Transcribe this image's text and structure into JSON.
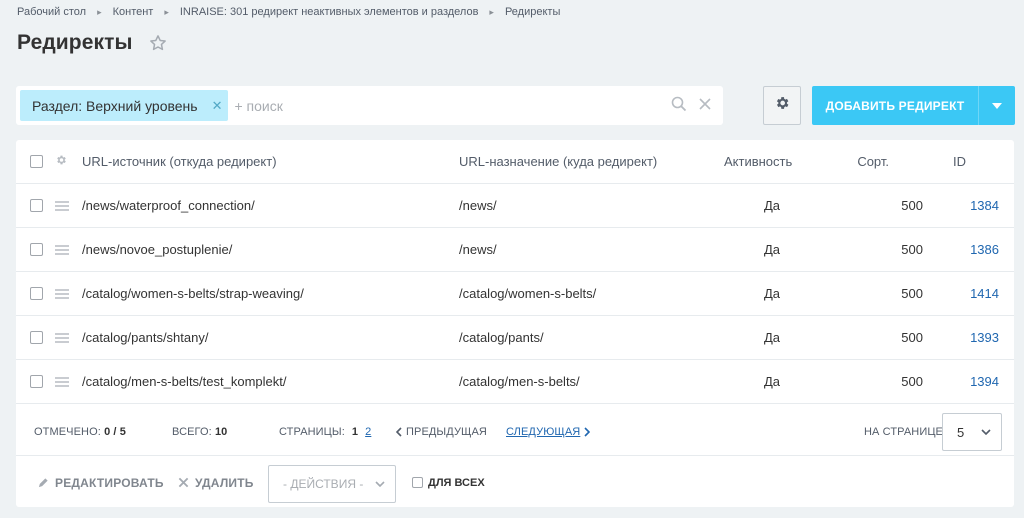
{
  "breadcrumbs": [
    {
      "label": "Рабочий стол"
    },
    {
      "label": "Контент"
    },
    {
      "label": "INRAISE: 301 редирект неактивных элементов и разделов"
    },
    {
      "label": "Редиректы"
    }
  ],
  "page": {
    "title": "Редиректы"
  },
  "filter": {
    "tag_label": "Раздел: Верхний уровень",
    "search_placeholder": "+ поиск"
  },
  "toolbar": {
    "add_label": "ДОБАВИТЬ РЕДИРЕКТ"
  },
  "table": {
    "columns": {
      "source": "URL-источник (откуда редирект)",
      "target": "URL-назначение (куда редирект)",
      "active": "Активность",
      "sort": "Сорт.",
      "id": "ID"
    },
    "rows": [
      {
        "source": "/news/waterproof_connection/",
        "target": "/news/",
        "active": "Да",
        "sort": "500",
        "id": "1384"
      },
      {
        "source": "/news/novoe_postuplenie/",
        "target": "/news/",
        "active": "Да",
        "sort": "500",
        "id": "1386"
      },
      {
        "source": "/catalog/women-s-belts/strap-weaving/",
        "target": "/catalog/women-s-belts/",
        "active": "Да",
        "sort": "500",
        "id": "1414"
      },
      {
        "source": "/catalog/pants/shtany/",
        "target": "/catalog/pants/",
        "active": "Да",
        "sort": "500",
        "id": "1393"
      },
      {
        "source": "/catalog/men-s-belts/test_komplekt/",
        "target": "/catalog/men-s-belts/",
        "active": "Да",
        "sort": "500",
        "id": "1394"
      }
    ]
  },
  "footer": {
    "checked_label": "ОТМЕЧЕНО:",
    "checked_value": "0 / 5",
    "total_label": "ВСЕГО:",
    "total_value": "10",
    "pages_label": "СТРАНИЦЫ:",
    "page_current": "1",
    "page_next": "2",
    "prev_label": "ПРЕДЫДУЩАЯ",
    "next_label": "СЛЕДУЮЩАЯ",
    "per_page_label": "НА СТРАНИЦЕ:",
    "per_page_value": "5"
  },
  "actions": {
    "edit_label": "РЕДАКТИРОВАТЬ",
    "delete_label": "УДАЛИТЬ",
    "actions_select": "- ДЕЙСТВИЯ -",
    "for_all_label": "ДЛЯ ВСЕХ"
  },
  "colors": {
    "accent": "#3bc8f5",
    "tag_bg": "#bcedfc",
    "link": "#2067b0",
    "background": "#eef2f4"
  },
  "icons": [
    "star-icon",
    "search-icon",
    "clear-icon",
    "gear-icon",
    "chevron-down-icon",
    "drag-handle-icon",
    "pencil-icon",
    "delete-icon"
  ]
}
